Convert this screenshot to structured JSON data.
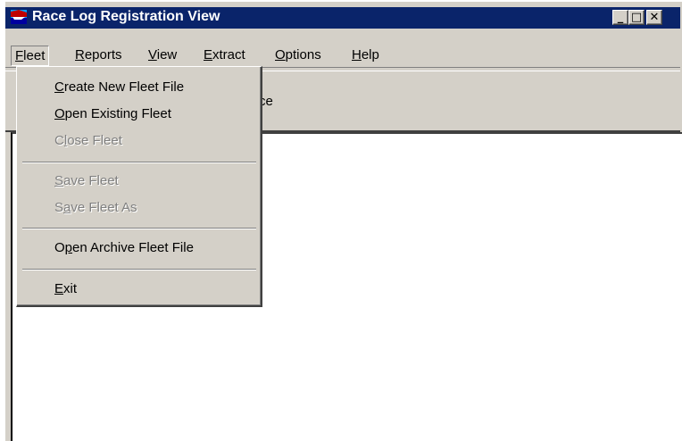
{
  "window": {
    "title": "Race Log Registration View",
    "controls": {
      "minimize": "_",
      "maximize": "□",
      "close": "✕"
    }
  },
  "menubar": {
    "items": [
      {
        "key": "F",
        "rest": "leet"
      },
      {
        "key": "R",
        "rest": "eports"
      },
      {
        "key": "V",
        "rest": "iew"
      },
      {
        "key": "E",
        "rest": "xtract"
      },
      {
        "key": "O",
        "rest": "ptions"
      },
      {
        "key": "H",
        "rest": "elp"
      }
    ]
  },
  "toolbar": {
    "label_partial": "ce"
  },
  "fleet_menu": {
    "items": [
      {
        "pre": "",
        "key": "C",
        "post": "reate New Fleet File",
        "enabled": true
      },
      {
        "pre": "",
        "key": "O",
        "post": "pen Existing Fleet",
        "enabled": true
      },
      {
        "pre": "C",
        "key": "l",
        "post": "ose Fleet",
        "enabled": false
      },
      {
        "pre": "",
        "key": "S",
        "post": "ave Fleet",
        "enabled": false
      },
      {
        "pre": "S",
        "key": "a",
        "post": "ve Fleet As",
        "enabled": false
      },
      {
        "pre": "O",
        "key": "p",
        "post": "en Archive Fleet File",
        "enabled": true
      },
      {
        "pre": "",
        "key": "E",
        "post": "xit",
        "enabled": true
      }
    ]
  },
  "colors": {
    "titlebar": "#0a246a",
    "face": "#d4d0c8",
    "disabled_text": "#808080"
  }
}
